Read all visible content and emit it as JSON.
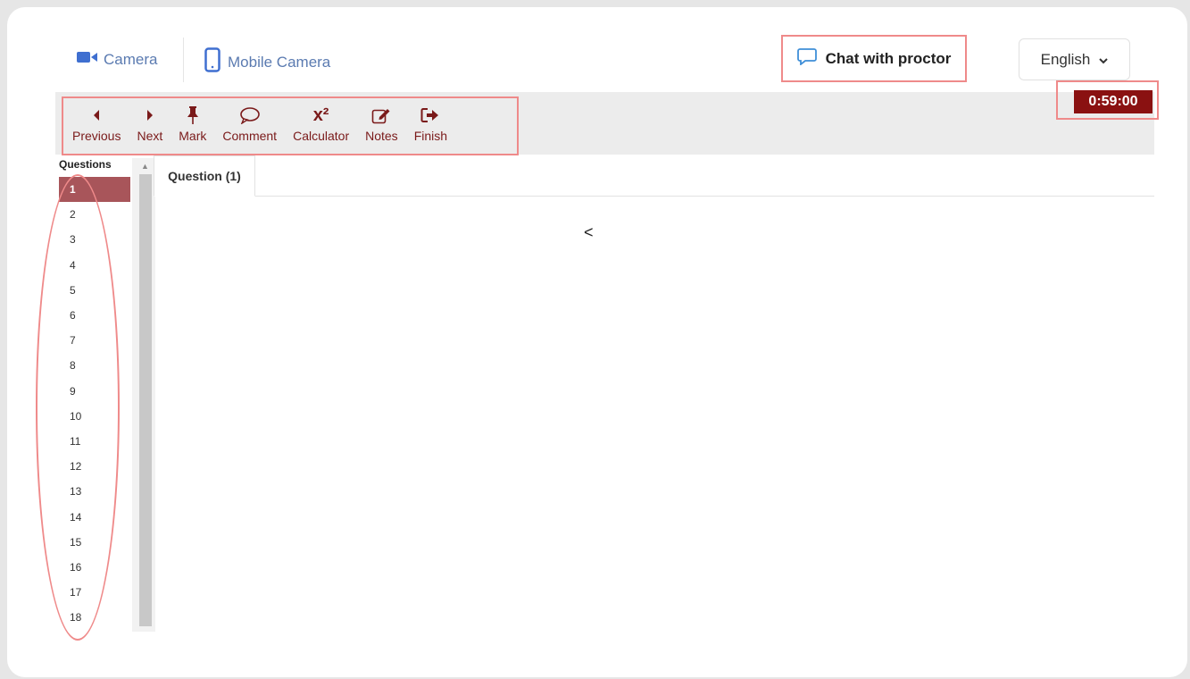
{
  "header": {
    "camera_tab": "Camera",
    "mobile_tab": "Mobile Camera",
    "chat_label": "Chat with proctor",
    "language": "English"
  },
  "toolbar": {
    "previous": "Previous",
    "next": "Next",
    "mark": "Mark",
    "comment": "Comment",
    "calculator": "Calculator",
    "calculator_icon_text": "x²",
    "notes": "Notes",
    "finish": "Finish"
  },
  "timer": "0:59:00",
  "questions": {
    "header": "Questions",
    "items": [
      "1",
      "2",
      "3",
      "4",
      "5",
      "6",
      "7",
      "8",
      "9",
      "10",
      "11",
      "12",
      "13",
      "14",
      "15",
      "16",
      "17",
      "18"
    ],
    "active": "1"
  },
  "content": {
    "tab_label": "Question (1)",
    "body_text": "<"
  },
  "colors": {
    "accent_dark_red": "#8a1111",
    "toolbar_icon": "#7a1a1a",
    "highlight_outline": "#ef8a8a",
    "link_blue": "#5b7bb1",
    "active_question": "#a8555a"
  }
}
